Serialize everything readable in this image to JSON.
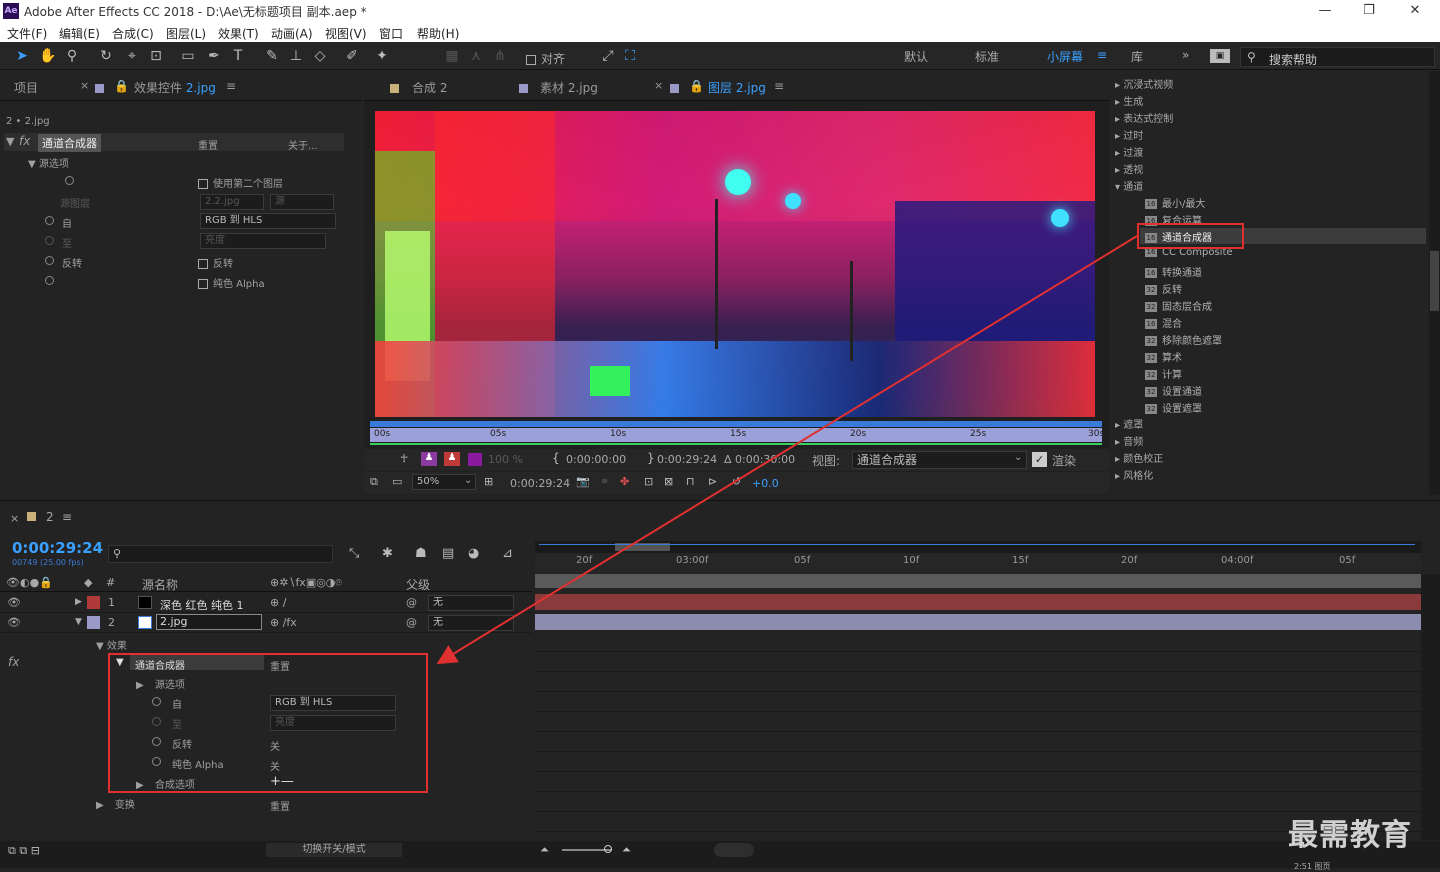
{
  "window": {
    "logo": "Ae",
    "title": "Adobe After Effects CC 2018 - D:\\Ae\\无标题项目 副本.aep *",
    "min": "—",
    "max": "❐",
    "close": "✕"
  },
  "menu": [
    "文件(F)",
    "编辑(E)",
    "合成(C)",
    "图层(L)",
    "效果(T)",
    "动画(A)",
    "视图(V)",
    "窗口",
    "帮助(H)"
  ],
  "toolbar": {
    "snap_label": "对齐",
    "workspaces": [
      "默认",
      "标准",
      "小屏幕",
      "库"
    ],
    "search_placeholder": "搜索帮助",
    "more": "»"
  },
  "left_panel": {
    "tab_project": "项目",
    "tab_effects": "效果控件",
    "tab_effects_file": "2.jpg",
    "path": "2 • 2.jpg",
    "effect_name": "通道合成器",
    "reset": "重置",
    "about": "关于...",
    "source_options": "源选项",
    "use_second_layer": "使用第二个图层",
    "source_layer_label": "源图层",
    "source_layer_value": "2.2.jpg",
    "source_value": "源",
    "from_label": "自",
    "from_value": "RGB 到 HLS",
    "to_label": "至",
    "to_value": "亮度",
    "invert_label": "反转",
    "solid_alpha_label": "纯色 Alpha"
  },
  "viewer": {
    "tabs": [
      "合成 2",
      "素材 2.jpg",
      "图层 2.jpg"
    ],
    "ruler": [
      "00s",
      "05s",
      "10s",
      "15s",
      "20s",
      "25s",
      "30s"
    ],
    "zoom_pct": "100 %",
    "time_start": "0:00:00:00",
    "time_end": "0:00:29:24",
    "time_dur": "Δ 0:00:30:00",
    "view_label": "视图:",
    "view_value": "通道合成器",
    "render_label": "渲染",
    "zoom": "50%",
    "current_time": "0:00:29:24",
    "exposure": "+0.0"
  },
  "effects_tree": {
    "categories_top": [
      "沉浸式视频",
      "生成",
      "表达式控制",
      "过时",
      "过渡",
      "透视"
    ],
    "channel": "通道",
    "items": [
      "最小/最大",
      "复合运算",
      "通道合成器",
      "CC Composite",
      "转换通道",
      "反转",
      "固态层合成",
      "混合",
      "移除颜色遮罩",
      "算术",
      "计算",
      "设置通道",
      "设置遮罩"
    ],
    "categories_bottom": [
      "遮罩",
      "音频",
      "颜色校正",
      "风格化"
    ]
  },
  "timeline": {
    "comp_tab": "2",
    "timecode": "0:00:29:24",
    "frame_info": "00749 (25.00 fps)",
    "search_placeholder": "",
    "col_num": "#",
    "col_source": "源名称",
    "col_parent": "父级",
    "layers": [
      {
        "num": "1",
        "name": "深色 红色 纯色 1",
        "parent": "无",
        "color": "#b03a3a"
      },
      {
        "num": "2",
        "name": "2.jpg",
        "parent": "无",
        "color": "#9a9ac8"
      }
    ],
    "effects_group": "效果",
    "effect_name": "通道合成器",
    "reset": "重置",
    "source_options": "源选项",
    "from_label": "自",
    "from_value": "RGB 到 HLS",
    "to_label": "至",
    "to_value": "亮度",
    "invert_label": "反转",
    "invert_value": "关",
    "solid_alpha_label": "纯色 Alpha",
    "solid_alpha_value": "关",
    "composite_options": "合成选项",
    "composite_icons": "+—",
    "transform": "变换",
    "transform_reset": "重置",
    "ticks": [
      "20f",
      "03:00f",
      "05f",
      "10f",
      "15f",
      "20f",
      "04:00f",
      "05f"
    ],
    "toggle_label": "切换开关/模式",
    "footer_frame": "2:51 图页"
  },
  "watermark": "最需教育",
  "colors": {
    "accent": "#3aa0ff",
    "annotation": "#e03030",
    "layer1": "#b03a3a",
    "layer2": "#9a9ac8"
  }
}
